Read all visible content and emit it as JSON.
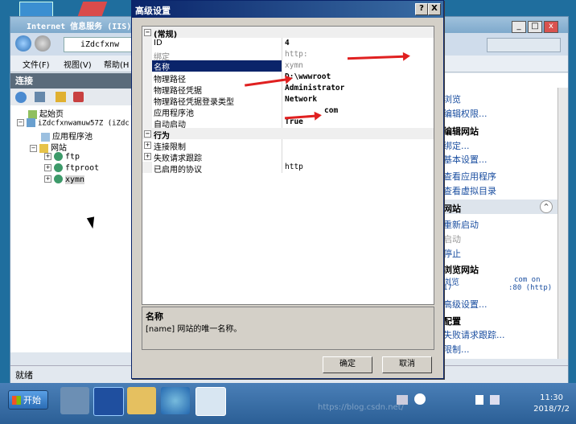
{
  "desktop": {
    "icon_names": [
      "computer-icon",
      "recycle-icon"
    ]
  },
  "iis": {
    "title": "Internet 信息服务 (IIS)",
    "address": "iZdcfxnw",
    "menu": {
      "file": "文件(F)",
      "view": "视图(V)",
      "help": "帮助(H"
    },
    "connections_label": "连接",
    "tree": {
      "start_page": "起始页",
      "server": "iZdcfxnwamuw57Z (iZdc",
      "app_pools": "应用程序池",
      "sites": "网站",
      "site_ftp": "ftp",
      "site_ftproot": "ftproot",
      "site_xymn": "xymn"
    },
    "status": "就绪",
    "actions": {
      "browse": "浏览",
      "edit_perms": "编辑权限...",
      "edit_site_header": "编辑网站",
      "bindings": "绑定...",
      "basic_settings": "基本设置...",
      "view_apps": "查看应用程序",
      "view_vdirs": "查看虚拟目录",
      "manage_site_header": "网站",
      "restart": "重新启动",
      "start": "启动",
      "stop": "停止",
      "browse_site_header": "浏览网站",
      "browse_line1": "浏览",
      "browse_line1b": "com on",
      "browse_line2": "17",
      "browse_line2b": ":80 (http)",
      "advanced": "高级设置...",
      "config_header": "配置",
      "failed_req": "失败请求跟踪...",
      "limits": "限制..."
    }
  },
  "dialog": {
    "title": "高级设置",
    "help_btn": "?",
    "close_btn": "X",
    "cat_general": "(常规)",
    "rows": {
      "id_k": "ID",
      "id_v": "4",
      "binding_k": "绑定",
      "binding_v": "http:",
      "name_k": "名称",
      "name_v": "xymn",
      "path_k": "物理路径",
      "path_v": "D:\\wwwroot",
      "cred_k": "物理路径凭据",
      "cred_v": "Administrator",
      "logon_k": "物理路径凭据登录类型",
      "logon_v": "Network",
      "pool_k": "应用程序池",
      "pool_v": "com",
      "autostart_k": "自动启动",
      "autostart_v": "True"
    },
    "cat_behavior": "行为",
    "behavior": {
      "limits_k": "连接限制",
      "fail_k": "失败请求跟踪",
      "proto_k": "已启用的协议",
      "proto_v": "http"
    },
    "desc_title": "名称",
    "desc_text": "[name] 网站的唯一名称。",
    "ok": "确定",
    "cancel": "取消"
  },
  "taskbar": {
    "start": "开始",
    "time": "11:30",
    "date": "2018/7/2",
    "watermark": "https://blog.csdn.net/"
  }
}
